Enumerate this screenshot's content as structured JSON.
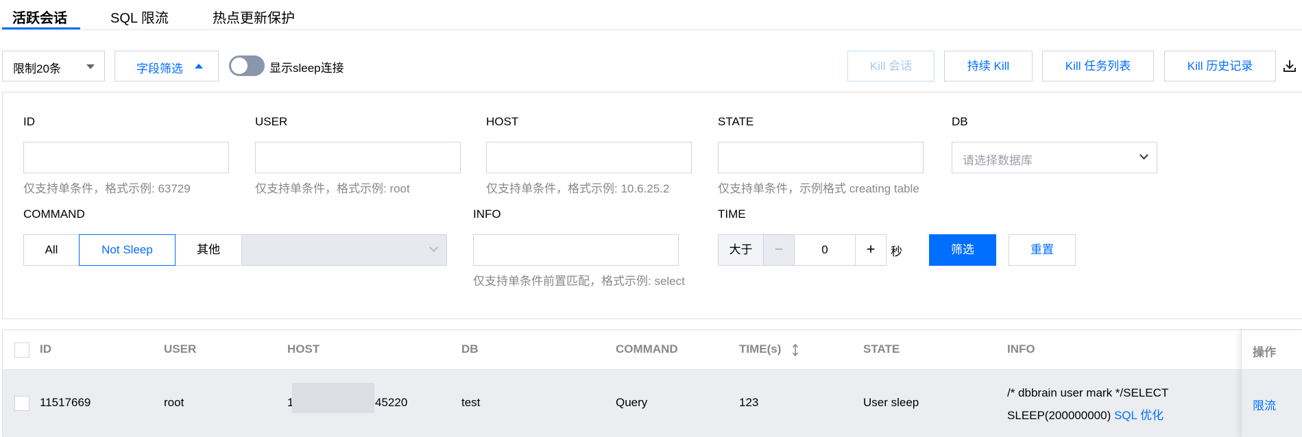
{
  "tabs": [
    {
      "label": "活跃会话",
      "active": true
    },
    {
      "label": "SQL 限流",
      "active": false
    },
    {
      "label": "热点更新保护",
      "active": false
    }
  ],
  "toolbar": {
    "limit_select": "限制20条",
    "field_filter": "字段筛选",
    "sleep_toggle_label": "显示sleep连接",
    "sleep_toggle_on": false,
    "buttons": {
      "kill_session": "Kill 会话",
      "continuous_kill": "持续 Kill",
      "kill_task_list": "Kill 任务列表",
      "kill_history": "Kill 历史记录"
    },
    "download_icon": "download-icon"
  },
  "filters": {
    "id": {
      "label": "ID",
      "value": "",
      "hint": "仅支持单条件，格式示例: 63729"
    },
    "user": {
      "label": "USER",
      "value": "",
      "hint": "仅支持单条件，格式示例: root"
    },
    "host": {
      "label": "HOST",
      "value": "",
      "hint": "仅支持单条件，格式示例: 10.6.25.2"
    },
    "state": {
      "label": "STATE",
      "value": "",
      "hint": "仅支持单条件，示例格式 creating table"
    },
    "db": {
      "label": "DB",
      "placeholder": "请选择数据库"
    },
    "command": {
      "label": "COMMAND",
      "options": [
        "All",
        "Not Sleep",
        "其他"
      ],
      "selected": "Not Sleep"
    },
    "info": {
      "label": "INFO",
      "value": "",
      "hint": "仅支持单条件前置匹配，格式示例: select"
    },
    "time": {
      "label": "TIME",
      "operator": "大于",
      "value": "0",
      "unit": "秒",
      "minus": "−",
      "plus": "+"
    },
    "submit": "筛选",
    "reset": "重置"
  },
  "table": {
    "columns": [
      "ID",
      "USER",
      "HOST",
      "DB",
      "COMMAND",
      "TIME(s)",
      "STATE",
      "INFO",
      "操作"
    ],
    "rows": [
      {
        "id": "11517669",
        "user": "root",
        "host_prefix": "1",
        "host_suffix": "45220",
        "db": "test",
        "command": "Query",
        "time": "123",
        "state": "User sleep",
        "info_line1": "/* dbbrain user mark */SELECT",
        "info_line2": "SLEEP(200000000)",
        "info_link": "SQL 优化",
        "action": "限流"
      }
    ]
  },
  "colors": {
    "accent": "#006eff",
    "hint": "#888888",
    "row_bg": "#ebedf1"
  }
}
